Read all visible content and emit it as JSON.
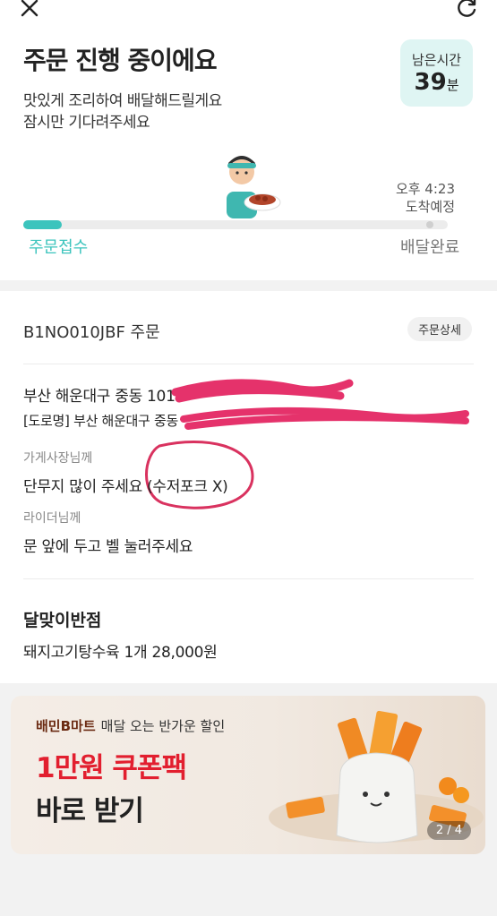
{
  "status": {
    "title": "주문 진행 중이에요",
    "line1": "맛있게 조리하여 배달해드릴게요",
    "line2": "잠시만 기다려주세요",
    "remaining_label": "남은시간",
    "remaining_value": "39",
    "remaining_unit": "분",
    "eta_time": "오후 4:23",
    "eta_label": "도착예정",
    "step_start": "주문접수",
    "step_end": "배달완료",
    "progress": 0.09,
    "accent_color": "#3cc4bd"
  },
  "order": {
    "id_text": "B1NO010JBF 주문",
    "detail_button": "주문상세",
    "address_line1": "부산 해운대구 중동 1018",
    "address_line2": "[도로명] 부산 해운대구 중동",
    "owner_label": "가게사장님께",
    "owner_request": "단무지 많이 주세요 (수저포크 X)",
    "rider_label": "라이더님께",
    "rider_request": "문 앞에 두고 벨 눌러주세요",
    "store_name": "달맞이반점",
    "item": "돼지고기탕수육 1개 28,000원"
  },
  "banner": {
    "brand": "배민B마트",
    "tagline": "매달 오는 반가운 할인",
    "headline1": "1만원 쿠폰팩",
    "headline2": "바로 받기",
    "pager": "2 / 4"
  }
}
